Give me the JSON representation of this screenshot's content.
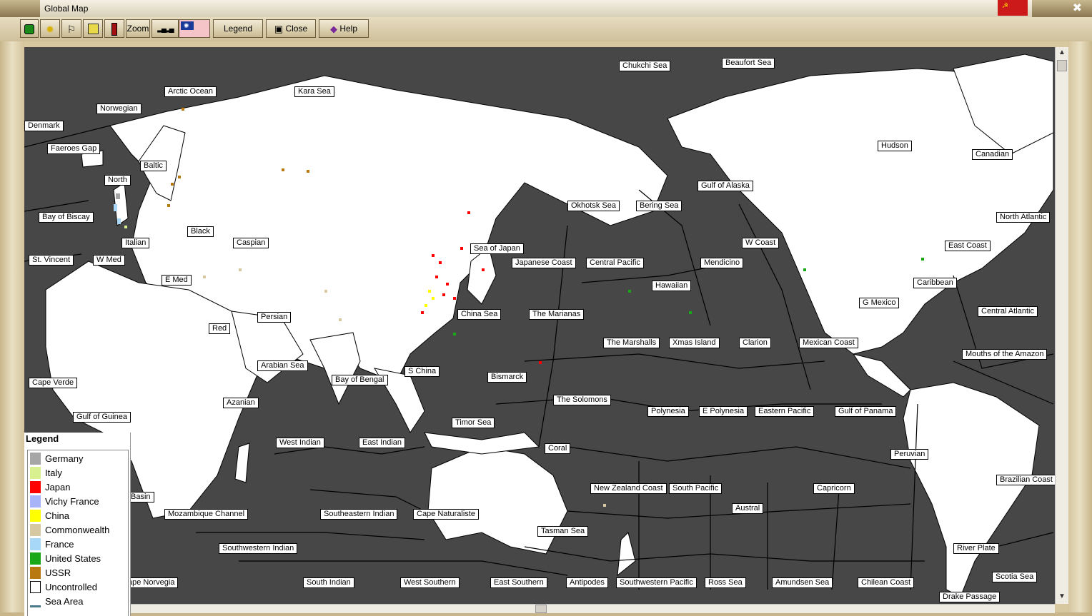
{
  "window": {
    "title": "Global Map"
  },
  "toolbar": {
    "zoom_label": "Zoom",
    "legend_label": "Legend",
    "close_label": "Close",
    "help_label": "Help"
  },
  "legend": {
    "title": "Legend",
    "items": [
      {
        "label": "Germany",
        "color": "#a6a6a6"
      },
      {
        "label": "Italy",
        "color": "#d8f090"
      },
      {
        "label": "Japan",
        "color": "#ff0000"
      },
      {
        "label": "Vichy France",
        "color": "#a8b4f8"
      },
      {
        "label": "China",
        "color": "#ffff00"
      },
      {
        "label": "Commonwealth",
        "color": "#d6c8a0"
      },
      {
        "label": "France",
        "color": "#a8d8f8"
      },
      {
        "label": "United States",
        "color": "#18a818"
      },
      {
        "label": "USSR",
        "color": "#b87a10"
      },
      {
        "label": "Uncontrolled",
        "color": "#ffffff"
      },
      {
        "label": "Sea Area",
        "color": "#474747"
      }
    ]
  },
  "regions": [
    {
      "name": "Chukchi Sea"
    },
    {
      "name": "Beaufort Sea"
    },
    {
      "name": "Arctic Ocean"
    },
    {
      "name": "Kara Sea"
    },
    {
      "name": "Norwegian"
    },
    {
      "name": "Denmark"
    },
    {
      "name": "Faeroes Gap"
    },
    {
      "name": "Baltic"
    },
    {
      "name": "North"
    },
    {
      "name": "Hudson"
    },
    {
      "name": "Canadian"
    },
    {
      "name": "Gulf of Alaska"
    },
    {
      "name": "Okhotsk Sea"
    },
    {
      "name": "Bering Sea"
    },
    {
      "name": "North Atlantic"
    },
    {
      "name": "Bay of Biscay"
    },
    {
      "name": "Black"
    },
    {
      "name": "Italian"
    },
    {
      "name": "Caspian"
    },
    {
      "name": "Sea of Japan"
    },
    {
      "name": "W Coast"
    },
    {
      "name": "East Coast"
    },
    {
      "name": "St. Vincent"
    },
    {
      "name": "W Med"
    },
    {
      "name": "Japanese Coast"
    },
    {
      "name": "Central Pacific"
    },
    {
      "name": "Mendicino"
    },
    {
      "name": "E Med"
    },
    {
      "name": "Hawaiian"
    },
    {
      "name": "Caribbean"
    },
    {
      "name": "G Mexico"
    },
    {
      "name": "China Sea"
    },
    {
      "name": "The Marianas"
    },
    {
      "name": "Central Atlantic"
    },
    {
      "name": "Persian"
    },
    {
      "name": "Red"
    },
    {
      "name": "The Marshalls"
    },
    {
      "name": "Xmas Island"
    },
    {
      "name": "Clarion"
    },
    {
      "name": "Mexican Coast"
    },
    {
      "name": "Mouths of the Amazon"
    },
    {
      "name": "Arabian Sea"
    },
    {
      "name": "S China"
    },
    {
      "name": "Bismarck"
    },
    {
      "name": "Bay of Bengal"
    },
    {
      "name": "Cape Verde"
    },
    {
      "name": "The Solomons"
    },
    {
      "name": "Azanian"
    },
    {
      "name": "Polynesia"
    },
    {
      "name": "E Polynesia"
    },
    {
      "name": "Eastern Pacific"
    },
    {
      "name": "Gulf of Panama"
    },
    {
      "name": "Gulf of Guinea"
    },
    {
      "name": "Timor Sea"
    },
    {
      "name": "West Indian"
    },
    {
      "name": "East Indian"
    },
    {
      "name": "Coral"
    },
    {
      "name": "Peruvian"
    },
    {
      "name": "Brazilian Coast"
    },
    {
      "name": "Basin"
    },
    {
      "name": "New Zealand Coast"
    },
    {
      "name": "South Pacific"
    },
    {
      "name": "Capricorn"
    },
    {
      "name": "Mozambique Channel"
    },
    {
      "name": "Southeastern Indian"
    },
    {
      "name": "Cape Naturaliste"
    },
    {
      "name": "Austral"
    },
    {
      "name": "Tasman Sea"
    },
    {
      "name": "Southwestern Indian"
    },
    {
      "name": "River Plate"
    },
    {
      "name": "Scotia Sea"
    },
    {
      "name": "ape Norvegia"
    },
    {
      "name": "South Indian"
    },
    {
      "name": "West Southern"
    },
    {
      "name": "East Southern"
    },
    {
      "name": "Antipodes"
    },
    {
      "name": "Southwestern Pacific"
    },
    {
      "name": "Ross Sea"
    },
    {
      "name": "Amundsen Sea"
    },
    {
      "name": "Chilean Coast"
    },
    {
      "name": "Drake Passage"
    }
  ]
}
